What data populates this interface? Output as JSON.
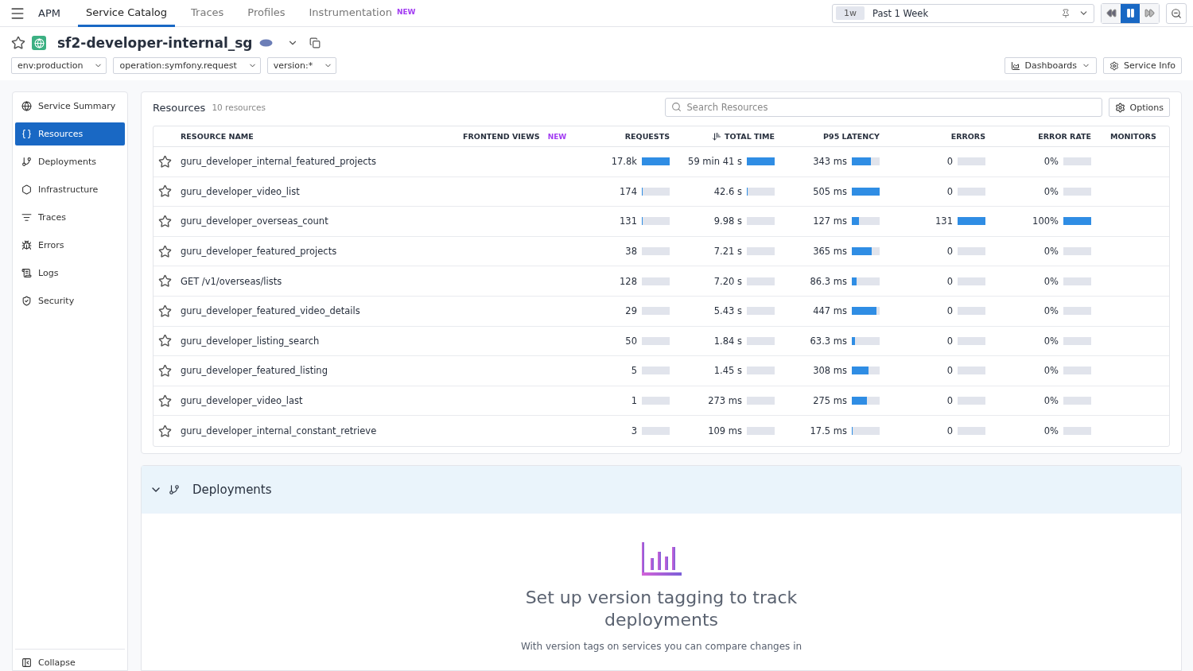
{
  "topnav": {
    "product": "APM",
    "tabs": [
      {
        "label": "Service Catalog",
        "selected": true
      },
      {
        "label": "Traces",
        "selected": false
      },
      {
        "label": "Profiles",
        "selected": false
      },
      {
        "label": "Instrumentation",
        "selected": false,
        "badge": "NEW"
      }
    ],
    "time": {
      "short": "1w",
      "label": "Past 1 Week"
    },
    "paused": true
  },
  "service": {
    "name": "sf2-developer-internal_sg",
    "starred": false
  },
  "filters": [
    "env:production",
    "operation:symfony.request",
    "version:*"
  ],
  "actions": [
    "Dashboards",
    "Service Info"
  ],
  "sidebar": {
    "items": [
      {
        "label": "Service Summary",
        "selected": false
      },
      {
        "label": "Resources",
        "selected": true
      },
      {
        "label": "Deployments",
        "selected": false
      },
      {
        "label": "Infrastructure",
        "selected": false
      },
      {
        "label": "Traces",
        "selected": false
      },
      {
        "label": "Errors",
        "selected": false
      },
      {
        "label": "Logs",
        "selected": false
      },
      {
        "label": "Security",
        "selected": false
      }
    ],
    "collapse": "Collapse"
  },
  "resources": {
    "title": "Resources",
    "count": "10 resources",
    "search_placeholder": "Search Resources",
    "options": "Options",
    "columns": [
      {
        "label": "RESOURCE NAME"
      },
      {
        "label": "FRONTEND VIEWS",
        "badge": "NEW"
      },
      {
        "label": "REQUESTS"
      },
      {
        "label": "TOTAL TIME",
        "sorted": true
      },
      {
        "label": "P95 LATENCY"
      },
      {
        "label": "ERRORS"
      },
      {
        "label": "ERROR RATE"
      },
      {
        "label": "MONITORS"
      }
    ],
    "rows": [
      {
        "name": "guru_developer_internal_featured_projects",
        "starred": false,
        "metrics": [
          {
            "value": "17.8k",
            "level": 1
          },
          {
            "value": "59 min 41 s",
            "level": 1
          },
          {
            "value": "343 ms",
            "level": 0.68
          },
          {
            "value": "0",
            "level": 0
          },
          {
            "value": "0%",
            "level": 0
          }
        ]
      },
      {
        "name": "guru_developer_video_list",
        "starred": false,
        "metrics": [
          {
            "value": "174",
            "level": 0.01
          },
          {
            "value": "42.6 s",
            "level": 0.01
          },
          {
            "value": "505 ms",
            "level": 1
          },
          {
            "value": "0",
            "level": 0
          },
          {
            "value": "0%",
            "level": 0
          }
        ]
      },
      {
        "name": "guru_developer_overseas_count",
        "starred": false,
        "metrics": [
          {
            "value": "131",
            "level": 0.01
          },
          {
            "value": "9.98 s",
            "level": 0
          },
          {
            "value": "127 ms",
            "level": 0.25
          },
          {
            "value": "131",
            "level": 1
          },
          {
            "value": "100%",
            "level": 1
          }
        ]
      },
      {
        "name": "guru_developer_featured_projects",
        "starred": false,
        "metrics": [
          {
            "value": "38",
            "level": 0
          },
          {
            "value": "7.21 s",
            "level": 0
          },
          {
            "value": "365 ms",
            "level": 0.72
          },
          {
            "value": "0",
            "level": 0
          },
          {
            "value": "0%",
            "level": 0
          }
        ]
      },
      {
        "name": "GET /v1/overseas/lists",
        "starred": false,
        "metrics": [
          {
            "value": "128",
            "level": 0
          },
          {
            "value": "7.20 s",
            "level": 0
          },
          {
            "value": "86.3 ms",
            "level": 0.17
          },
          {
            "value": "0",
            "level": 0
          },
          {
            "value": "0%",
            "level": 0
          }
        ]
      },
      {
        "name": "guru_developer_featured_video_details",
        "starred": false,
        "metrics": [
          {
            "value": "29",
            "level": 0
          },
          {
            "value": "5.43 s",
            "level": 0
          },
          {
            "value": "447 ms",
            "level": 0.88
          },
          {
            "value": "0",
            "level": 0
          },
          {
            "value": "0%",
            "level": 0
          }
        ]
      },
      {
        "name": "guru_developer_listing_search",
        "starred": false,
        "metrics": [
          {
            "value": "50",
            "level": 0
          },
          {
            "value": "1.84 s",
            "level": 0
          },
          {
            "value": "63.3 ms",
            "level": 0.12
          },
          {
            "value": "0",
            "level": 0
          },
          {
            "value": "0%",
            "level": 0
          }
        ]
      },
      {
        "name": "guru_developer_featured_listing",
        "starred": false,
        "metrics": [
          {
            "value": "5",
            "level": 0
          },
          {
            "value": "1.45 s",
            "level": 0
          },
          {
            "value": "308 ms",
            "level": 0.61
          },
          {
            "value": "0",
            "level": 0
          },
          {
            "value": "0%",
            "level": 0
          }
        ]
      },
      {
        "name": "guru_developer_video_last",
        "starred": false,
        "metrics": [
          {
            "value": "1",
            "level": 0
          },
          {
            "value": "273 ms",
            "level": 0
          },
          {
            "value": "275 ms",
            "level": 0.54
          },
          {
            "value": "0",
            "level": 0
          },
          {
            "value": "0%",
            "level": 0
          }
        ]
      },
      {
        "name": "guru_developer_internal_constant_retrieve",
        "starred": false,
        "metrics": [
          {
            "value": "3",
            "level": 0
          },
          {
            "value": "109 ms",
            "level": 0
          },
          {
            "value": "17.5 ms",
            "level": 0.03
          },
          {
            "value": "0",
            "level": 0
          },
          {
            "value": "0%",
            "level": 0
          }
        ]
      }
    ]
  },
  "deployments": {
    "title": "Deployments",
    "expanded": true,
    "heading": "Set up version tagging to track deployments",
    "text": "With version tags on services you can compare changes in"
  }
}
